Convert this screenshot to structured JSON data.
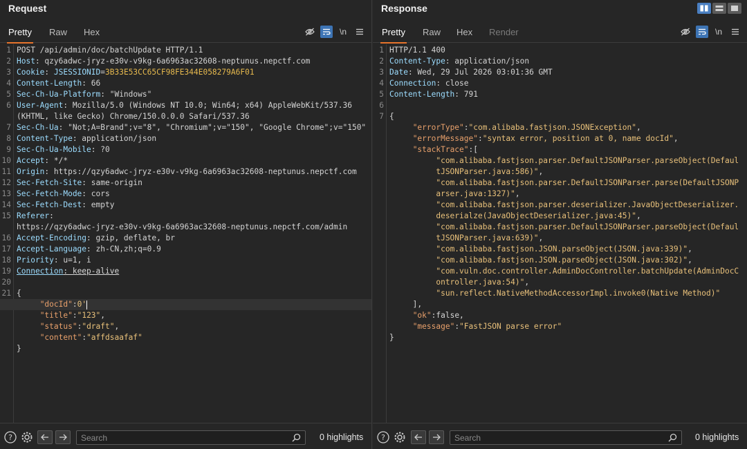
{
  "request": {
    "title": "Request",
    "tabs": [
      "Pretty",
      "Raw",
      "Hex"
    ],
    "active_tab": "Pretty",
    "footer": {
      "search_placeholder": "Search",
      "highlights": "0 highlights"
    },
    "lines": [
      {
        "n": "1",
        "segs": [
          [
            "val",
            "POST /api/admin/doc/batchUpdate HTTP/1.1"
          ]
        ]
      },
      {
        "n": "2",
        "segs": [
          [
            "k",
            "Host"
          ],
          [
            "val",
            ": qzy6adwc-jryz-e30v-v9kg-6a6963ac32608-neptunus.nepctf.com"
          ]
        ]
      },
      {
        "n": "3",
        "segs": [
          [
            "k",
            "Cookie"
          ],
          [
            "val",
            ": "
          ],
          [
            "k",
            "JSESSIONID"
          ],
          [
            "val",
            "="
          ],
          [
            "sess",
            "3B33E53CC65CF98FE344E058279A6F01"
          ]
        ]
      },
      {
        "n": "4",
        "segs": [
          [
            "k",
            "Content-Length"
          ],
          [
            "val",
            ": 66"
          ]
        ]
      },
      {
        "n": "5",
        "segs": [
          [
            "k",
            "Sec-Ch-Ua-Platform"
          ],
          [
            "val",
            ": \"Windows\""
          ]
        ]
      },
      {
        "n": "6",
        "segs": [
          [
            "k",
            "User-Agent"
          ],
          [
            "val",
            ": Mozilla/5.0 (Windows NT 10.0; Win64; x64) AppleWebKit/537.36"
          ]
        ]
      },
      {
        "n": "",
        "segs": [
          [
            "val",
            "(KHTML, like Gecko) Chrome/150.0.0.0 Safari/537.36"
          ]
        ]
      },
      {
        "n": "7",
        "segs": [
          [
            "k",
            "Sec-Ch-Ua"
          ],
          [
            "val",
            ": \"Not;A=Brand\";v=\"8\", \"Chromium\";v=\"150\", \"Google Chrome\";v=\"150\""
          ]
        ]
      },
      {
        "n": "8",
        "segs": [
          [
            "k",
            "Content-Type"
          ],
          [
            "val",
            ": application/json"
          ]
        ]
      },
      {
        "n": "9",
        "segs": [
          [
            "k",
            "Sec-Ch-Ua-Mobile"
          ],
          [
            "val",
            ": ?0"
          ]
        ]
      },
      {
        "n": "10",
        "segs": [
          [
            "k",
            "Accept"
          ],
          [
            "val",
            ": */*"
          ]
        ]
      },
      {
        "n": "11",
        "segs": [
          [
            "k",
            "Origin"
          ],
          [
            "val",
            ": https://qzy6adwc-jryz-e30v-v9kg-6a6963ac32608-neptunus.nepctf.com"
          ]
        ]
      },
      {
        "n": "12",
        "segs": [
          [
            "k",
            "Sec-Fetch-Site"
          ],
          [
            "val",
            ": same-origin"
          ]
        ]
      },
      {
        "n": "13",
        "segs": [
          [
            "k",
            "Sec-Fetch-Mode"
          ],
          [
            "val",
            ": cors"
          ]
        ]
      },
      {
        "n": "14",
        "segs": [
          [
            "k",
            "Sec-Fetch-Dest"
          ],
          [
            "val",
            ": empty"
          ]
        ]
      },
      {
        "n": "15",
        "segs": [
          [
            "k",
            "Referer"
          ],
          [
            "val",
            ":"
          ]
        ]
      },
      {
        "n": "",
        "segs": [
          [
            "val",
            "https://qzy6adwc-jryz-e30v-v9kg-6a6963ac32608-neptunus.nepctf.com/admin"
          ]
        ]
      },
      {
        "n": "16",
        "segs": [
          [
            "k",
            "Accept-Encoding"
          ],
          [
            "val",
            ": gzip, deflate, br"
          ]
        ]
      },
      {
        "n": "17",
        "segs": [
          [
            "k",
            "Accept-Language"
          ],
          [
            "val",
            ": zh-CN,zh;q=0.9"
          ]
        ]
      },
      {
        "n": "18",
        "segs": [
          [
            "k",
            "Priority"
          ],
          [
            "val",
            ": u=1, i"
          ]
        ]
      },
      {
        "n": "19",
        "segs": [
          [
            "ku",
            "Connection"
          ],
          [
            "u",
            ": keep-alive"
          ]
        ]
      },
      {
        "n": "20",
        "segs": []
      },
      {
        "n": "21",
        "segs": [
          [
            "val",
            "{"
          ]
        ]
      },
      {
        "n": "",
        "segs": [
          [
            "val",
            "     "
          ],
          [
            "jk",
            "\"docId\""
          ],
          [
            "val",
            ":"
          ],
          [
            "js",
            "0'"
          ],
          [
            "cursor",
            ""
          ]
        ],
        "active": true
      },
      {
        "n": "",
        "segs": [
          [
            "val",
            "     "
          ],
          [
            "jk",
            "\"title\""
          ],
          [
            "val",
            ":"
          ],
          [
            "js",
            "\"123\""
          ],
          [
            "val",
            ","
          ]
        ]
      },
      {
        "n": "",
        "segs": [
          [
            "val",
            "     "
          ],
          [
            "jk",
            "\"status\""
          ],
          [
            "val",
            ":"
          ],
          [
            "js",
            "\"draft\""
          ],
          [
            "val",
            ","
          ]
        ]
      },
      {
        "n": "",
        "segs": [
          [
            "val",
            "     "
          ],
          [
            "jk",
            "\"content\""
          ],
          [
            "val",
            ":"
          ],
          [
            "js",
            "\"affdsaafaf\""
          ]
        ]
      },
      {
        "n": "",
        "segs": [
          [
            "val",
            "}"
          ]
        ]
      }
    ]
  },
  "response": {
    "title": "Response",
    "tabs": [
      "Pretty",
      "Raw",
      "Hex",
      "Render"
    ],
    "active_tab": "Pretty",
    "footer": {
      "search_placeholder": "Search",
      "highlights": "0 highlights"
    },
    "lines": [
      {
        "n": "1",
        "segs": [
          [
            "val",
            "HTTP/1.1 400"
          ]
        ]
      },
      {
        "n": "2",
        "segs": [
          [
            "k",
            "Content-Type"
          ],
          [
            "val",
            ": application/json"
          ]
        ]
      },
      {
        "n": "3",
        "segs": [
          [
            "k",
            "Date"
          ],
          [
            "val",
            ": Wed, 29 Jul 2026 03:01:36 GMT"
          ]
        ]
      },
      {
        "n": "4",
        "segs": [
          [
            "k",
            "Connection"
          ],
          [
            "val",
            ": close"
          ]
        ]
      },
      {
        "n": "5",
        "segs": [
          [
            "k",
            "Content-Length"
          ],
          [
            "val",
            ": 791"
          ]
        ]
      },
      {
        "n": "6",
        "segs": []
      },
      {
        "n": "7",
        "segs": [
          [
            "val",
            "{"
          ]
        ]
      },
      {
        "n": "",
        "segs": [
          [
            "val",
            "     "
          ],
          [
            "jk",
            "\"errorType\""
          ],
          [
            "val",
            ":"
          ],
          [
            "js",
            "\"com.alibaba.fastjson.JSONException\""
          ],
          [
            "val",
            ","
          ]
        ]
      },
      {
        "n": "",
        "segs": [
          [
            "val",
            "     "
          ],
          [
            "jk",
            "\"errorMessage\""
          ],
          [
            "val",
            ":"
          ],
          [
            "js",
            "\"syntax error, position at 0, name docId\""
          ],
          [
            "val",
            ","
          ]
        ]
      },
      {
        "n": "",
        "segs": [
          [
            "val",
            "     "
          ],
          [
            "jk",
            "\"stackTrace\""
          ],
          [
            "val",
            ":["
          ]
        ]
      },
      {
        "n": "",
        "segs": [
          [
            "val",
            "          "
          ],
          [
            "js",
            "\"com.alibaba.fastjson.parser.DefaultJSONParser.parseObject(Defaul"
          ]
        ]
      },
      {
        "n": "",
        "segs": [
          [
            "js",
            "          tJSONParser.java:586)\""
          ],
          [
            "val",
            ","
          ]
        ]
      },
      {
        "n": "",
        "segs": [
          [
            "val",
            "          "
          ],
          [
            "js",
            "\"com.alibaba.fastjson.parser.DefaultJSONParser.parse(DefaultJSONP"
          ]
        ]
      },
      {
        "n": "",
        "segs": [
          [
            "js",
            "          arser.java:1327)\""
          ],
          [
            "val",
            ","
          ]
        ]
      },
      {
        "n": "",
        "segs": [
          [
            "val",
            "          "
          ],
          [
            "js",
            "\"com.alibaba.fastjson.parser.deserializer.JavaObjectDeserializer."
          ]
        ]
      },
      {
        "n": "",
        "segs": [
          [
            "js",
            "          deserialze(JavaObjectDeserializer.java:45)\""
          ],
          [
            "val",
            ","
          ]
        ]
      },
      {
        "n": "",
        "segs": [
          [
            "val",
            "          "
          ],
          [
            "js",
            "\"com.alibaba.fastjson.parser.DefaultJSONParser.parseObject(Defaul"
          ]
        ]
      },
      {
        "n": "",
        "segs": [
          [
            "js",
            "          tJSONParser.java:639)\""
          ],
          [
            "val",
            ","
          ]
        ]
      },
      {
        "n": "",
        "segs": [
          [
            "val",
            "          "
          ],
          [
            "js",
            "\"com.alibaba.fastjson.JSON.parseObject(JSON.java:339)\""
          ],
          [
            "val",
            ","
          ]
        ]
      },
      {
        "n": "",
        "segs": [
          [
            "val",
            "          "
          ],
          [
            "js",
            "\"com.alibaba.fastjson.JSON.parseObject(JSON.java:302)\""
          ],
          [
            "val",
            ","
          ]
        ]
      },
      {
        "n": "",
        "segs": [
          [
            "val",
            "          "
          ],
          [
            "js",
            "\"com.vuln.doc.controller.AdminDocController.batchUpdate(AdminDocC"
          ]
        ]
      },
      {
        "n": "",
        "segs": [
          [
            "js",
            "          ontroller.java:54)\""
          ],
          [
            "val",
            ","
          ]
        ]
      },
      {
        "n": "",
        "segs": [
          [
            "val",
            "          "
          ],
          [
            "js",
            "\"sun.reflect.NativeMethodAccessorImpl.invoke0(Native Method)\""
          ]
        ]
      },
      {
        "n": "",
        "segs": [
          [
            "val",
            "     ],"
          ]
        ]
      },
      {
        "n": "",
        "segs": [
          [
            "val",
            "     "
          ],
          [
            "jk",
            "\"ok\""
          ],
          [
            "val",
            ":false,"
          ]
        ]
      },
      {
        "n": "",
        "segs": [
          [
            "val",
            "     "
          ],
          [
            "jk",
            "\"message\""
          ],
          [
            "val",
            ":"
          ],
          [
            "js",
            "\"FastJSON parse error\""
          ]
        ]
      },
      {
        "n": "",
        "segs": [
          [
            "val",
            "}"
          ]
        ]
      }
    ]
  },
  "icons": {
    "hide": "eye-off-icon",
    "wrap": "word-wrap-icon",
    "newline": "\\n",
    "menu": "menu-icon",
    "help": "?",
    "settings": "gear-icon"
  }
}
